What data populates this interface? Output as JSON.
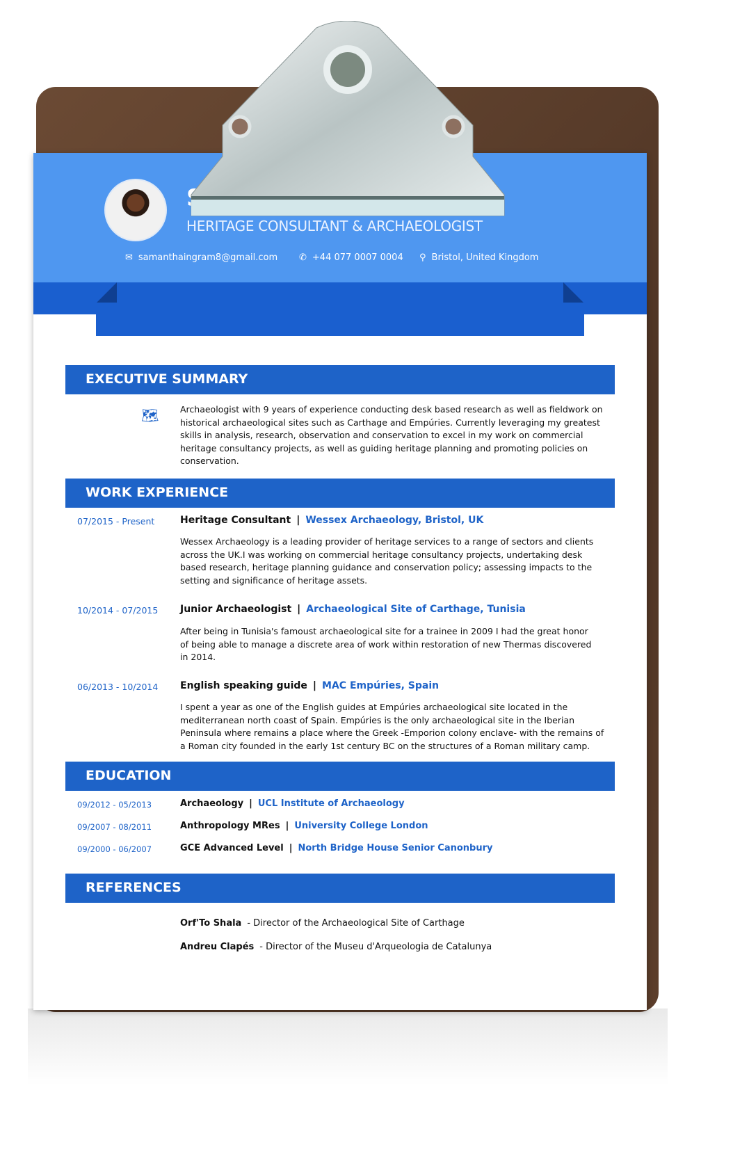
{
  "header": {
    "name": "S",
    "title": "HERITAGE CONSULTANT & ARCHAEOLOGIST",
    "email": "samanthaingram8@gmail.com",
    "phone": "+44 077 0007 0004",
    "location": "Bristol, United Kingdom"
  },
  "colors": {
    "header": "#4f97f0",
    "accent": "#1e63c8",
    "board": "#5c3e2b"
  },
  "summary": {
    "heading": "EXECUTIVE SUMMARY",
    "text": "Archaeologist with 9 years of experience conducting desk based research as well as fieldwork on historical archaeological sites such as Carthage and Empúries. Currently leveraging my greatest skills in analysis, research, observation and conservation to excel in my work on commercial heritage consultancy projects, as well as guiding heritage planning and promoting policies on conservation."
  },
  "work": {
    "heading": "WORK EXPERIENCE",
    "items": [
      {
        "date": "07/2015 - Present",
        "role": "Heritage Consultant",
        "org": "Wessex Archaeology, Bristol, UK",
        "desc": "Wessex Archaeology is a leading provider of heritage services to a range of sectors and clients across the UK.I was working on commercial heritage consultancy projects, undertaking desk based research, heritage planning guidance and conservation policy; assessing impacts to the setting and significance of heritage assets."
      },
      {
        "date": "10/2014 - 07/2015",
        "role": "Junior Archaeologist",
        "org": "Archaeological Site of Carthage, Tunisia",
        "desc": "After being in Tunisia's famoust archaeological site for a trainee in 2009 I had the great honor of being able to manage a discrete area of work within restoration of new Thermas discovered in 2014."
      },
      {
        "date": "06/2013 - 10/2014",
        "role": "English speaking guide",
        "org": "MAC Empúries, Spain",
        "desc": "I spent a year as one of the English guides at Empúries archaeological site located in the mediterranean north coast of Spain. Empúries is the only archaeological site in the Iberian Peninsula where remains a place where the Greek -Emporion colony enclave- with the remains of a Roman city founded in the early 1st century BC on the structures of a Roman military camp."
      }
    ]
  },
  "education": {
    "heading": "EDUCATION",
    "items": [
      {
        "date": "09/2012 - 05/2013",
        "degree": "Archaeology",
        "school": "UCL Institute of Archaeology"
      },
      {
        "date": "09/2007 - 08/2011",
        "degree": "Anthropology MRes",
        "school": "University College London"
      },
      {
        "date": "09/2000 - 06/2007",
        "degree": "GCE Advanced Level",
        "school": "North Bridge House Senior Canonbury"
      }
    ]
  },
  "references": {
    "heading": "REFERENCES",
    "items": [
      {
        "name": "Orf'To Shala",
        "role": "Director of the Archaeological Site of Carthage"
      },
      {
        "name": "Andreu Clapés",
        "role": "Director of the Museu d'Arqueologia de Catalunya"
      }
    ]
  },
  "separator": "|",
  "dash": "-"
}
